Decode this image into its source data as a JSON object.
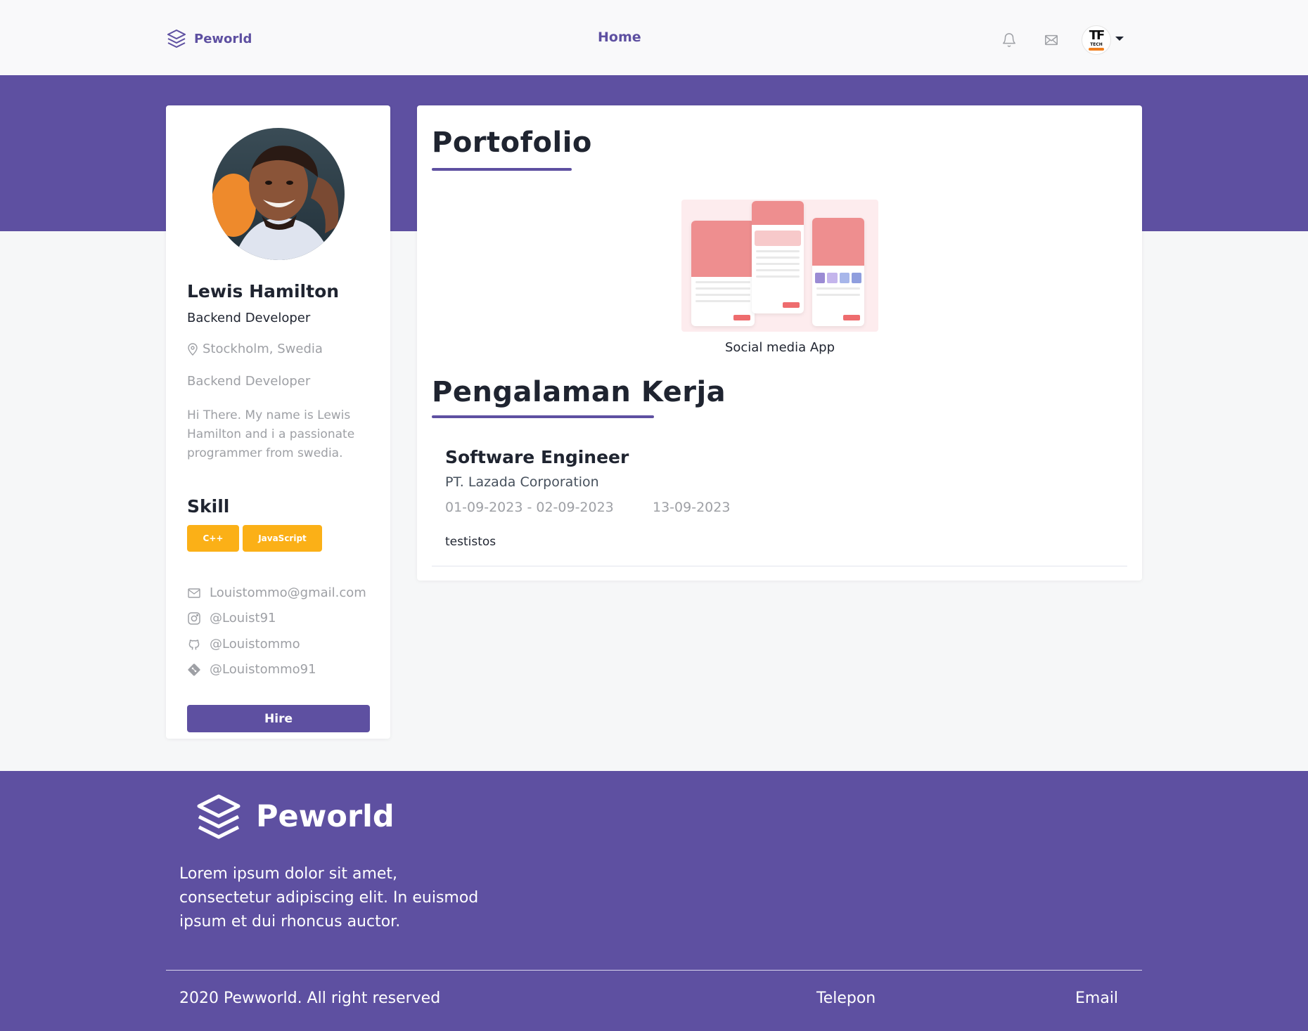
{
  "nav": {
    "brand": "Peworld",
    "home_label": "Home",
    "icons": [
      "bell-icon",
      "mail-icon"
    ],
    "avatar_text": "TF",
    "avatar_subtext": "TECH"
  },
  "profile": {
    "name": "Lewis Hamilton",
    "job": "Backend Developer",
    "location": "Stockholm, Swedia",
    "role": "Backend Developer",
    "bio": "Hi There. My name is Lewis Hamilton and i a passionate programmer from swedia.",
    "skill_title": "Skill",
    "skills": [
      "C++",
      "JavaScript"
    ],
    "contacts": {
      "email": "Louistommo@gmail.com",
      "instagram": "@Louist91",
      "github": "@Louistommo",
      "gitlab": "@Louistommo91"
    },
    "hire_label": "Hire"
  },
  "portfolio": {
    "title": "Portofolio",
    "items": [
      {
        "caption": "Social media App"
      }
    ]
  },
  "experience": {
    "title": "Pengalaman Kerja",
    "items": [
      {
        "position": "Software Engineer",
        "company": "PT. Lazada Corporation",
        "dates": "01-09-2023 - 02-09-2023",
        "duration": "13-09-2023",
        "description": "testistos"
      }
    ]
  },
  "footer": {
    "brand": "Peworld",
    "description": "Lorem ipsum dolor sit amet, consectetur adipiscing elit. In euismod ipsum et dui rhoncus auctor.",
    "copyright": "2020 Pewworld. All right reserved",
    "links": [
      "Telepon",
      "Email"
    ]
  },
  "colors": {
    "primary": "#5e50a1",
    "skill": "#fbb017",
    "muted": "#9ea0a5"
  }
}
